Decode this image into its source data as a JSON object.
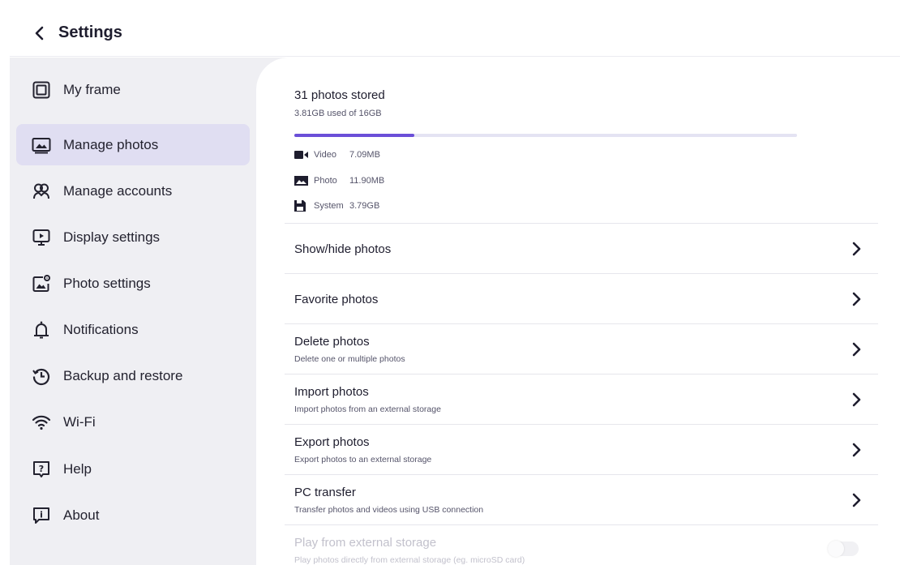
{
  "header": {
    "title": "Settings"
  },
  "sidebar": {
    "items": [
      {
        "label": "My frame",
        "icon": "frame-icon"
      },
      {
        "label": "Manage photos",
        "icon": "photos-icon",
        "active": true
      },
      {
        "label": "Manage accounts",
        "icon": "accounts-icon"
      },
      {
        "label": "Display settings",
        "icon": "display-icon"
      },
      {
        "label": "Photo settings",
        "icon": "photo-settings-icon"
      },
      {
        "label": "Notifications",
        "icon": "bell-icon"
      },
      {
        "label": "Backup and restore",
        "icon": "history-icon"
      },
      {
        "label": "Wi-Fi",
        "icon": "wifi-icon"
      },
      {
        "label": "Help",
        "icon": "help-icon"
      },
      {
        "label": "About",
        "icon": "info-icon"
      }
    ]
  },
  "storage": {
    "title": "31 photos stored",
    "subtitle": "3.81GB used of 16GB",
    "used_fraction": 0.238,
    "accent_color": "#6b4fd8",
    "stats": [
      {
        "name": "Video",
        "value": "7.09MB",
        "icon": "video-camera-icon"
      },
      {
        "name": "Photo",
        "value": "11.90MB",
        "icon": "image-icon"
      },
      {
        "name": "System",
        "value": "3.79GB",
        "icon": "floppy-disk-icon"
      }
    ]
  },
  "rows": [
    {
      "title": "Show/hide photos",
      "subtitle": ""
    },
    {
      "title": "Favorite photos",
      "subtitle": ""
    },
    {
      "title": "Delete photos",
      "subtitle": "Delete one or multiple photos"
    },
    {
      "title": "Import photos",
      "subtitle": "Import photos from an external storage"
    },
    {
      "title": "Export photos",
      "subtitle": "Export photos to an external storage"
    },
    {
      "title": "PC transfer",
      "subtitle": "Transfer photos and videos using USB connection"
    },
    {
      "title": "Play from external storage",
      "subtitle": "Play photos directly from external storage (eg. microSD card)",
      "toggle": false,
      "disabled": true
    }
  ]
}
